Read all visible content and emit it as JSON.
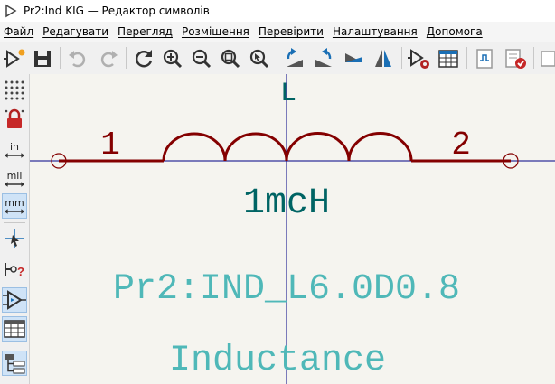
{
  "window": {
    "title": "Pr2:Ind KIG — Редактор символів"
  },
  "menu": [
    "Файл",
    "Редагувати",
    "Перегляд",
    "Розміщення",
    "Перевірити",
    "Налаштування",
    "Допомога"
  ],
  "symbol": {
    "reference": "L",
    "value": "1mcH",
    "footprint": "Pr2:IND_L6.0D0.8",
    "description": "Inductance",
    "pin1": "1",
    "pin2": "2"
  },
  "left_toolbar": {
    "units_in": "in",
    "units_mil": "mil",
    "units_mm": "mm",
    "active_unit": "mm"
  },
  "colors": {
    "body": "#840000",
    "reference": "#006464",
    "value": "#006464",
    "fields": "#4fb8b8",
    "axis": "#000084",
    "canvas_bg": "#f5f4ef",
    "grid_dots": "#1a1a1a",
    "accent": "#1a6fb5"
  },
  "icons": {
    "toolbar": [
      "new-symbol-icon",
      "save-icon",
      "undo-icon",
      "redo-icon",
      "refresh-icon",
      "zoom-in-icon",
      "zoom-out-icon",
      "zoom-fit-icon",
      "zoom-selection-icon",
      "rotate-ccw-icon",
      "rotate-cw-icon",
      "mirror-h-icon",
      "mirror-v-icon",
      "symbol-properties-icon",
      "pin-table-icon",
      "preview-icon",
      "check-symbol-icon",
      "unit-select-icon"
    ],
    "left": [
      "grid-icon",
      "lock-icon",
      "units-inch-icon",
      "units-mil-icon",
      "units-mm-icon",
      "cursor-icon",
      "pin-type-icon",
      "show-electrical-icon",
      "table-icon",
      "hierarchy-icon"
    ]
  }
}
